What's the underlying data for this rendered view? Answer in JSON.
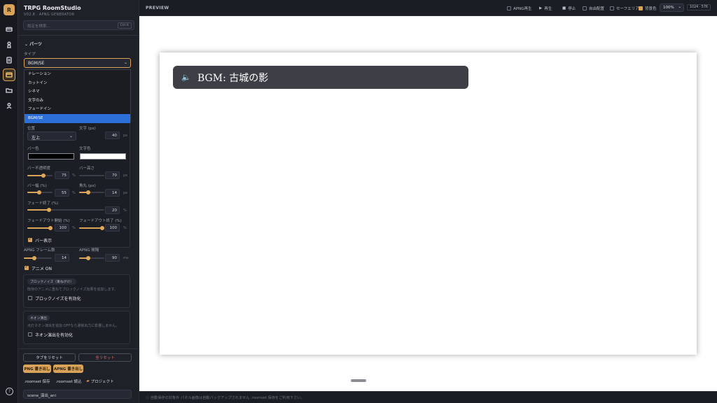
{
  "app": {
    "logo_letter": "R",
    "title": "TRPG RoomStudio",
    "subtitle": "V02.8 · APNG GENERATOR"
  },
  "rail": {
    "items": [
      "card-icon",
      "pawn-icon",
      "document-icon",
      "layout-icon",
      "folder-icon",
      "user-icon"
    ],
    "active": 3
  },
  "search": {
    "placeholder": "設定を検索...",
    "shortcut": "Ctrl K"
  },
  "parts": {
    "section": "パーツ",
    "type_label": "タイプ",
    "type_value": "BGM/SE",
    "type_options": [
      "ナレーション",
      "カットイン",
      "シネマ",
      "文字のみ",
      "フェードイン",
      "BGM/SE"
    ],
    "type_selected": "BGM/SE"
  },
  "form": {
    "position_label": "位置",
    "position_value": "左上",
    "fontsize_label": "文字 (px)",
    "fontsize_value": "40",
    "fontsize_unit": "px",
    "barcolor_label": "バー色",
    "textcolor_label": "文字色",
    "bar_color": "#000000",
    "text_color": "#ffffff",
    "opacity_label": "バー不透明度",
    "opacity_value": "75",
    "opacity_unit": "%",
    "height_label": "バー高さ",
    "height_value": "70",
    "height_unit": "px",
    "width_label": "バー幅 (%)",
    "width_value": "55",
    "width_unit": "%",
    "radius_label": "角丸 (px)",
    "radius_value": "14",
    "radius_unit": "px",
    "fadeend_label": "フェード終了 (%)",
    "fadeend_value": "20",
    "fadeend_unit": "%",
    "fadeoutstart_label": "フェードアウト開始 (%)",
    "fadeoutstart_value": "100",
    "fadeoutstart_unit": "%",
    "fadeoutend_label": "フェードアウト終了 (%)",
    "fadeoutend_value": "100",
    "fadeoutend_unit": "%",
    "bar_show_label": "バー表示"
  },
  "apng": {
    "frames_label": "APNG フレーム数",
    "frames_value": "14",
    "interval_label": "APNG 間隔",
    "interval_value": "90",
    "interval_unit": "ms",
    "anime_label": "アニメ ON"
  },
  "blocknoise": {
    "pill": "ブロックノイズ（重ねがけ）",
    "desc": "既存のアニメに重ねてブロックノイズ効果を追加します。",
    "checkbox": "ブロックノイズを有効化"
  },
  "neon": {
    "pill": "ネオン演出",
    "desc": "点灯ネオン演出を追加 OFFなら通常出力に影響しません。",
    "checkbox": "ネオン演出を有効化"
  },
  "buttons": {
    "reset_tab": "タブをリセット",
    "reset_all": "全リセット",
    "png_export": "PNG 書き出し",
    "apng_export": "APNG 書き出し",
    "save_roomset": ".roomset 保存",
    "load_roomset": ".roomset 読込",
    "project": "プロジェクト"
  },
  "filename": "scene_演出_ani",
  "topbar": {
    "title": "PREVIEW",
    "apng_play": "APNG再生",
    "play": "再生",
    "stop": "停止",
    "auto_layout": "自由配置",
    "safe_area": "セーフエリア",
    "bg": "背景色",
    "zoom": "100%",
    "resolution": "1024 · 576"
  },
  "preview": {
    "bgm_text": "BGM: 古城の影"
  },
  "status": "ⓘ 自動保存の対象外 パネル画像は自動バックアップされません .roomset 保存をご利用下さい。",
  "colors": {
    "accent": "#d9a35a",
    "selected": "#2d6fd8",
    "bar": "#3e3f46"
  }
}
